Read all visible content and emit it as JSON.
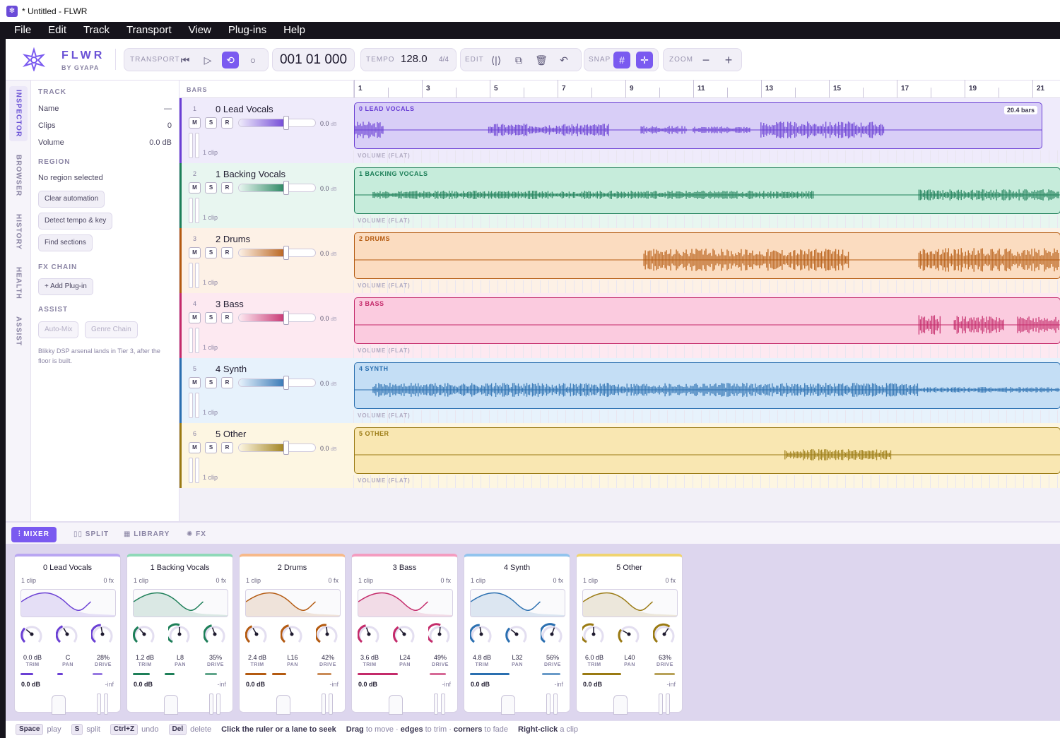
{
  "window": {
    "title": "* Untitled - FLWR"
  },
  "menu": [
    "File",
    "Edit",
    "Track",
    "Transport",
    "View",
    "Plug-ins",
    "Help"
  ],
  "brand": {
    "name": "FLWR",
    "sub": "BY GYAPA"
  },
  "toolbar": {
    "transport_label": "TRANSPORT",
    "timecode": "001 01 000",
    "tempo_label": "TEMPO",
    "tempo": "128.0",
    "signature": "4/4",
    "edit_label": "EDIT",
    "snap_label": "SNAP",
    "zoom_label": "ZOOM",
    "zoom_out": "−",
    "zoom_in": "+"
  },
  "sidetabs": [
    "INSPECTOR",
    "BROWSER",
    "HISTORY",
    "HEALTH",
    "ASSIST"
  ],
  "inspector": {
    "track_head": "TRACK",
    "rows": [
      {
        "label": "Name",
        "value": "—"
      },
      {
        "label": "Clips",
        "value": "0"
      },
      {
        "label": "Volume",
        "value": "0.0 dB"
      }
    ],
    "region_head": "REGION",
    "region_text": "No region selected",
    "buttons": [
      "Clear automation",
      "Detect tempo & key",
      "Find sections"
    ],
    "fx_head": "FX CHAIN",
    "add_plugin": "+ Add Plug-in",
    "assist_head": "ASSIST",
    "assist_buttons": [
      "Auto-Mix",
      "Genre Chain"
    ],
    "note": "Blikky DSP arsenal lands in Tier 3, after the floor is built."
  },
  "arrange": {
    "bars_label": "BARS",
    "ruler": [
      "1",
      "3",
      "5",
      "7",
      "9",
      "11",
      "13",
      "15",
      "17",
      "19",
      "21"
    ]
  },
  "tracks": [
    {
      "num": "1",
      "name": "0 Lead Vocals",
      "vol": "0.0",
      "unit": "dB",
      "clips": "1 clip",
      "clip_label": "0 LEAD VOCALS",
      "badge": "20.4 bars",
      "auto": "VOLUME (FLAT)",
      "color": "#6a3fd4",
      "bg": "#efebfb",
      "clipbg": "#d8cef7"
    },
    {
      "num": "2",
      "name": "1 Backing Vocals",
      "vol": "0.0",
      "unit": "dB",
      "clips": "1 clip",
      "clip_label": "1 BACKING VOCALS",
      "badge": "",
      "auto": "VOLUME (FLAT)",
      "color": "#1d7f58",
      "bg": "#e8f6f0",
      "clipbg": "#c6ecdb"
    },
    {
      "num": "3",
      "name": "2 Drums",
      "vol": "0.0",
      "unit": "dB",
      "clips": "1 clip",
      "clip_label": "2 DRUMS",
      "badge": "",
      "auto": "VOLUME (FLAT)",
      "color": "#b45a10",
      "bg": "#fdf1e6",
      "clipbg": "#fbdcc0"
    },
    {
      "num": "4",
      "name": "3 Bass",
      "vol": "0.0",
      "unit": "dB",
      "clips": "1 clip",
      "clip_label": "3 BASS",
      "badge": "",
      "auto": "VOLUME (FLAT)",
      "color": "#c42a6a",
      "bg": "#fde9f1",
      "clipbg": "#fbcbdf"
    },
    {
      "num": "5",
      "name": "4 Synth",
      "vol": "0.0",
      "unit": "dB",
      "clips": "1 clip",
      "clip_label": "4 SYNTH",
      "badge": "",
      "auto": "VOLUME (FLAT)",
      "color": "#2a6fb0",
      "bg": "#e7f2fc",
      "clipbg": "#c4def5"
    },
    {
      "num": "6",
      "name": "5 Other",
      "vol": "0.0",
      "unit": "dB",
      "clips": "1 clip",
      "clip_label": "5 OTHER",
      "badge": "",
      "auto": "VOLUME (FLAT)",
      "color": "#9a7a12",
      "bg": "#fdf6e2",
      "clipbg": "#f9e7b2"
    }
  ],
  "bottom_tabs": [
    "MIXER",
    "SPLIT",
    "LIBRARY",
    "FX"
  ],
  "mixer": [
    {
      "name": "0 Lead Vocals",
      "clips": "1 clip",
      "fx": "0 fx",
      "trim": "0.0 dB",
      "pan": "C",
      "drive": "28%",
      "db": "0.0 dB",
      "inf": "-inf",
      "color": "#6a3fd4",
      "top": "#b9a6f2"
    },
    {
      "name": "1 Backing Vocals",
      "clips": "1 clip",
      "fx": "0 fx",
      "trim": "1.2 dB",
      "pan": "L8",
      "drive": "35%",
      "db": "0.0 dB",
      "inf": "-inf",
      "color": "#1d7f58",
      "top": "#8fd9b8"
    },
    {
      "name": "2 Drums",
      "clips": "1 clip",
      "fx": "0 fx",
      "trim": "2.4 dB",
      "pan": "L16",
      "drive": "42%",
      "db": "0.0 dB",
      "inf": "-inf",
      "color": "#b45a10",
      "top": "#f7b98a"
    },
    {
      "name": "3 Bass",
      "clips": "1 clip",
      "fx": "0 fx",
      "trim": "3.6 dB",
      "pan": "L24",
      "drive": "49%",
      "db": "0.0 dB",
      "inf": "-inf",
      "color": "#c42a6a",
      "top": "#f49cc0"
    },
    {
      "name": "4 Synth",
      "clips": "1 clip",
      "fx": "0 fx",
      "trim": "4.8 dB",
      "pan": "L32",
      "drive": "56%",
      "db": "0.0 dB",
      "inf": "-inf",
      "color": "#2a6fb0",
      "top": "#92c4ee"
    },
    {
      "name": "5 Other",
      "clips": "1 clip",
      "fx": "0 fx",
      "trim": "6.0 dB",
      "pan": "L40",
      "drive": "63%",
      "db": "0.0 dB",
      "inf": "-inf",
      "color": "#9a7a12",
      "top": "#f0d470"
    }
  ],
  "knob_labels": [
    "TRIM",
    "PAN",
    "DRIVE"
  ],
  "status": {
    "space": "Space",
    "play": "play",
    "s": "S",
    "split": "split",
    "ctrlz": "Ctrl+Z",
    "undo": "undo",
    "del": "Del",
    "delete": "delete",
    "click": "Click the ruler or a lane to seek",
    "drag": "Drag",
    "move": "to move ·",
    "edges": "edges",
    "trim": "to trim ·",
    "corners": "corners",
    "fade": "to fade",
    "rclick": "Right-click",
    "aclip": "a clip"
  }
}
